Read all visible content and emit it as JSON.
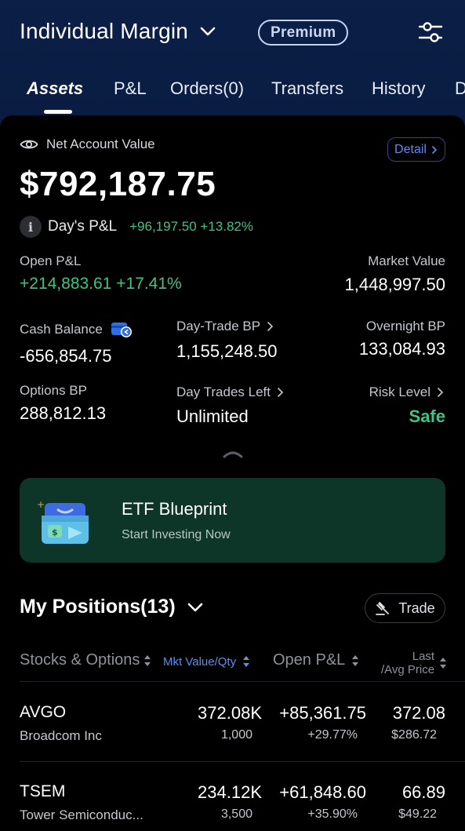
{
  "header": {
    "account_name": "Individual Margin",
    "badge": "Premium"
  },
  "tabs": [
    {
      "label": "Assets",
      "active": true
    },
    {
      "label": "P&L"
    },
    {
      "label": "Orders(0)"
    },
    {
      "label": "Transfers"
    },
    {
      "label": "History"
    },
    {
      "label": "D"
    }
  ],
  "account": {
    "net_label": "Net Account Value",
    "detail_label": "Detail",
    "net_value": "$792,187.75",
    "day_pl_label": "Day's P&L",
    "day_pl_value": "+96,197.50 +13.82%",
    "open_pl_label": "Open P&L",
    "open_pl_value": "+214,883.61 +17.41%",
    "market_value_label": "Market Value",
    "market_value": "1,448,997.50",
    "cash_balance_label": "Cash Balance",
    "cash_balance": "-656,854.75",
    "day_trade_bp_label": "Day-Trade BP",
    "day_trade_bp": "1,155,248.50",
    "overnight_bp_label": "Overnight BP",
    "overnight_bp": "133,084.93",
    "options_bp_label": "Options BP",
    "options_bp": "288,812.13",
    "day_trades_left_label": "Day Trades Left",
    "day_trades_left": "Unlimited",
    "risk_level_label": "Risk Level",
    "risk_level": "Safe"
  },
  "banner": {
    "title": "ETF Blueprint",
    "subtitle": "Start Investing Now"
  },
  "positions": {
    "title": "My Positions(13)",
    "trade_label": "Trade",
    "columns": {
      "symbol": "Stocks & Options",
      "mkt": "Mkt Value/Qty",
      "open_pl": "Open P&L",
      "last_line1": "Last",
      "last_line2": "/Avg Price"
    },
    "rows": [
      {
        "symbol": "AVGO",
        "name": "Broadcom Inc",
        "mkt_value": "372.08K",
        "qty": "1,000",
        "open_pl": "+85,361.75",
        "open_pl_pct": "+29.77%",
        "last": "372.08",
        "avg": "$286.72"
      },
      {
        "symbol": "TSEM",
        "name": "Tower Semiconduc...",
        "mkt_value": "234.12K",
        "qty": "3,500",
        "open_pl": "+61,848.60",
        "open_pl_pct": "+35.90%",
        "last": "66.89",
        "avg": "$49.22"
      }
    ]
  },
  "colors": {
    "header_bg": "#0b1f47",
    "positive": "#3ec485",
    "accent_blue": "#5b8ef0",
    "banner_bg": "#0d3528"
  }
}
